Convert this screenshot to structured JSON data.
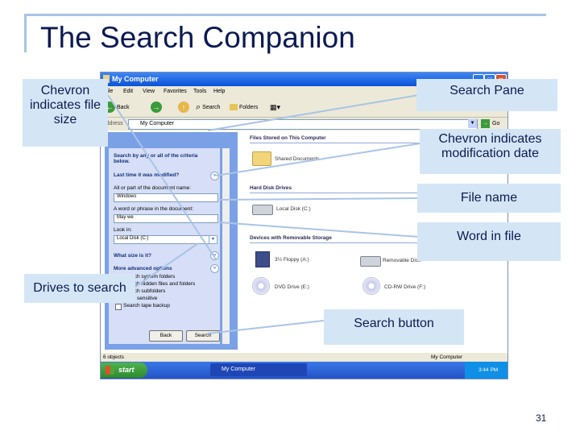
{
  "slide": {
    "title": "The Search Companion",
    "page_number": "31"
  },
  "callouts": {
    "chevron_file_size": "Chevron indicates file size",
    "search_pane": "Search Pane",
    "chevron_mod_date": "Chevron indicates modification date",
    "file_name": "File name",
    "word_in_file": "Word in file",
    "drives_to_search": "Drives to search",
    "search_button": "Search button"
  },
  "window": {
    "title": "My Computer",
    "menu": [
      "File",
      "Edit",
      "View",
      "Favorites",
      "Tools",
      "Help"
    ],
    "toolbar": {
      "back": "Back",
      "search": "Search",
      "folders": "Folders"
    },
    "address": {
      "label": "Address",
      "value": "My Computer",
      "go": "Go"
    }
  },
  "search_pane": {
    "heading": "Search by any or all of the criteria below.",
    "last_modified": "Last time it was modified?",
    "name_label": "All or part of the document name:",
    "name_value": "Windows",
    "phrase_label": "A word or phrase in the document:",
    "phrase_value": "May we",
    "look_in_label": "Look in:",
    "look_in_value": "Local Disk (C:)",
    "size_label": "What size is it?",
    "more_options": "More advanced options",
    "options": [
      "Search system folders",
      "Search hidden files and folders",
      "Search subfolders",
      "Case sensitive",
      "Search tape backup"
    ],
    "back_button": "Back",
    "search_button": "Search"
  },
  "content": {
    "groups": [
      {
        "title": "Files Stored on This Computer"
      },
      {
        "title": "Hard Disk Drives"
      },
      {
        "title": "Devices with Removable Storage"
      }
    ],
    "items": {
      "shared_docs": "Shared Documents",
      "local_disk": "Local Disk (C:)",
      "floppy": "3½ Floppy (A:)",
      "removable": "Removable Disk",
      "dvd": "DVD Drive (E:)",
      "cd": "CD-RW Drive (F:)"
    }
  },
  "status_bar": {
    "left": "6 objects",
    "right": "My Computer"
  },
  "taskbar": {
    "start": "start",
    "task": "My Computer",
    "clock": "3:44 PM"
  },
  "colors": {
    "title_text": "#0b1a52",
    "callout_bg": "#d4e6f6",
    "connector": "#a9c4e6",
    "xp_blue": "#0a52d8",
    "pane_blue": "#7aa1e6"
  }
}
